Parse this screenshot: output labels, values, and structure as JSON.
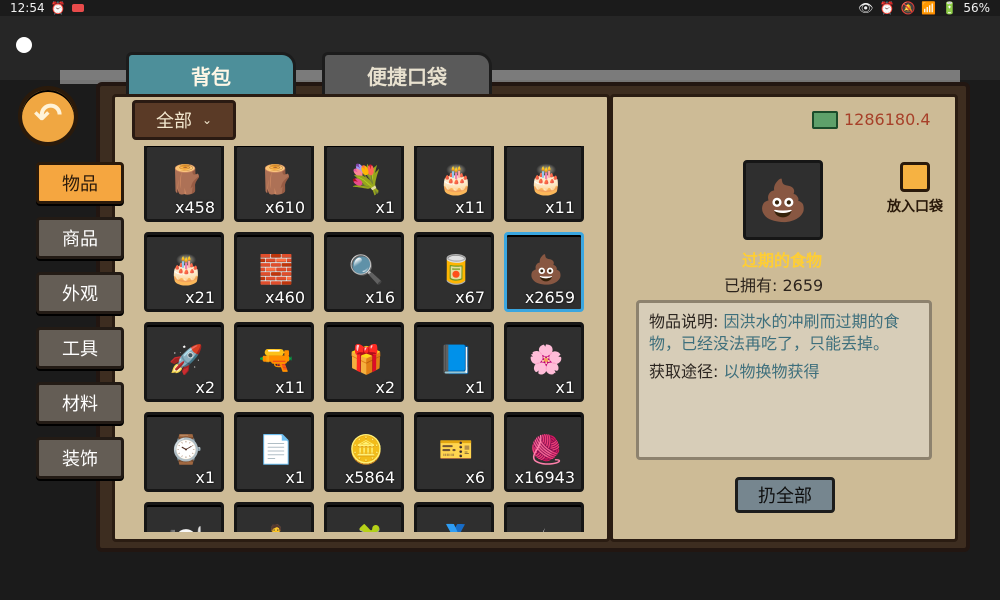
{
  "status": {
    "time": "12:54",
    "battery": "56%"
  },
  "tabs": {
    "backpack": "背包",
    "pocket": "便捷口袋"
  },
  "dropdown": {
    "label": "全部"
  },
  "categories": [
    "物品",
    "商品",
    "外观",
    "工具",
    "材料",
    "装饰"
  ],
  "items": [
    {
      "count": "x458",
      "icon": "log-icon",
      "glyph": "🪵"
    },
    {
      "count": "x610",
      "icon": "log-icon",
      "glyph": "🪵"
    },
    {
      "count": "x1",
      "icon": "flower-bouquet-icon",
      "glyph": "💐"
    },
    {
      "count": "x11",
      "icon": "cake-icon",
      "glyph": "🎂"
    },
    {
      "count": "x11",
      "icon": "cake-icon",
      "glyph": "🎂"
    },
    {
      "count": "x21",
      "icon": "cake-icon",
      "glyph": "🎂"
    },
    {
      "count": "x460",
      "icon": "cement-bag-icon",
      "glyph": "🧱"
    },
    {
      "count": "x16",
      "icon": "magnifier-icon",
      "glyph": "🔍"
    },
    {
      "count": "x67",
      "icon": "canned-food-icon",
      "glyph": "🥫"
    },
    {
      "count": "x2659",
      "icon": "expired-food-icon",
      "glyph": "💩",
      "selected": true
    },
    {
      "count": "x2",
      "icon": "rocket-icon",
      "glyph": "🚀"
    },
    {
      "count": "x11",
      "icon": "gadget-icon",
      "glyph": "🔫"
    },
    {
      "count": "x2",
      "icon": "gift-box-icon",
      "glyph": "🎁"
    },
    {
      "count": "x1",
      "icon": "book-icon",
      "glyph": "📘"
    },
    {
      "count": "x1",
      "icon": "flower-icon",
      "glyph": "🌸"
    },
    {
      "count": "x1",
      "icon": "watch-icon",
      "glyph": "⌚"
    },
    {
      "count": "x1",
      "icon": "document-icon",
      "glyph": "📄"
    },
    {
      "count": "x5864",
      "icon": "coin-icon",
      "glyph": "🪙"
    },
    {
      "count": "x6",
      "icon": "ticket-icon",
      "glyph": "🎫"
    },
    {
      "count": "x16943",
      "icon": "knot-icon",
      "glyph": "🧶"
    },
    {
      "count": "",
      "icon": "plate-icon",
      "glyph": "🍽️"
    },
    {
      "count": "",
      "icon": "figure-icon",
      "glyph": "🧍"
    },
    {
      "count": "",
      "icon": "puzzle-icon",
      "glyph": "🧩"
    },
    {
      "count": "",
      "icon": "badge-icon",
      "glyph": "🏅"
    },
    {
      "count": "",
      "icon": "mug-icon",
      "glyph": "☕"
    }
  ],
  "money": "1286180.4",
  "selected": {
    "name": "过期的食物",
    "owned": "已拥有: 2659"
  },
  "desc": {
    "label1": "物品说明:",
    "text1": "因洪水的冲刷而过期的食物，已经没法再吃了，只能丢掉。",
    "label2": "获取途径:",
    "text2": "以物换物获得"
  },
  "pocket_btn": "放入口袋",
  "throw_btn": "扔全部"
}
